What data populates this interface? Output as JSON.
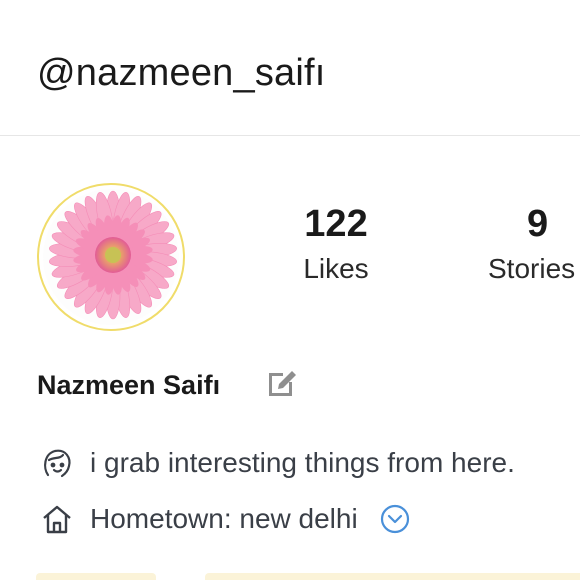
{
  "profile": {
    "username": "@nazmeen_saifı",
    "display_name": "Nazmeen Saifı",
    "avatar_icon": "pink-gerbera-flower",
    "accent_ring_color": "#f0dc6a"
  },
  "stats": [
    {
      "value": "122",
      "label": "Likes"
    },
    {
      "value": "9",
      "label": "Stories"
    }
  ],
  "bio": {
    "line1_icon": "face-icon",
    "line1": "i grab interesting things from here.",
    "line2_icon": "home-icon",
    "line2": "Hometown: new delhi",
    "expand_icon": "chevron-down-circle-icon",
    "expand_color": "#4a90d9"
  }
}
